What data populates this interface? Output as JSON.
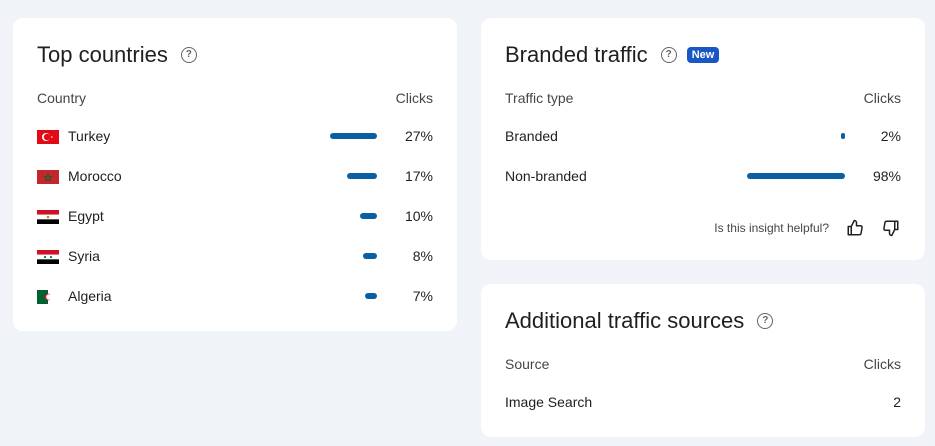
{
  "top_countries": {
    "title": "Top countries",
    "col_left": "Country",
    "col_right": "Clicks",
    "rows": [
      {
        "name": "Turkey",
        "value": "27%",
        "pct": 27
      },
      {
        "name": "Morocco",
        "value": "17%",
        "pct": 17
      },
      {
        "name": "Egypt",
        "value": "10%",
        "pct": 10
      },
      {
        "name": "Syria",
        "value": "8%",
        "pct": 8
      },
      {
        "name": "Algeria",
        "value": "7%",
        "pct": 7
      }
    ]
  },
  "branded_traffic": {
    "title": "Branded traffic",
    "badge": "New",
    "col_left": "Traffic type",
    "col_right": "Clicks",
    "rows": [
      {
        "name": "Branded",
        "value": "2%",
        "pct": 2
      },
      {
        "name": "Non-branded",
        "value": "98%",
        "pct": 98
      }
    ],
    "feedback_prompt": "Is this insight helpful?"
  },
  "additional_sources": {
    "title": "Additional traffic sources",
    "col_left": "Source",
    "col_right": "Clicks",
    "rows": [
      {
        "name": "Image Search",
        "value": "2"
      }
    ]
  },
  "colors": {
    "bar": "#0a5fa3",
    "badge": "#1a56c4",
    "background": "#f0f3f8"
  }
}
